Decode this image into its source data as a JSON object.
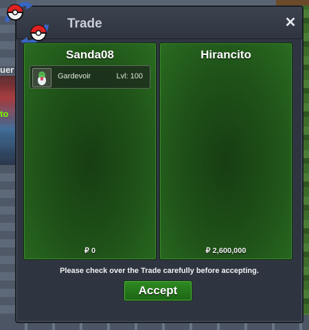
{
  "window": {
    "title": "Trade",
    "close_label": "✕"
  },
  "left_panel": {
    "name": "Sanda08",
    "items": [
      {
        "name": "Gardevoir",
        "level": "Lvl: 100",
        "icon": "gardevoir-pokemon-icon"
      }
    ],
    "money": "₽ 0"
  },
  "right_panel": {
    "name": "Hirancito",
    "items": [],
    "money": "₽ 2,600,000"
  },
  "notice": "Please check over the Trade carefully before accepting.",
  "accept_label": "Accept",
  "background": {
    "text_1": "uer",
    "text_2": "to"
  },
  "colors": {
    "panel_green": "#1f5318",
    "accept_green": "#2f8a22",
    "window_bg": "#2f3540"
  }
}
